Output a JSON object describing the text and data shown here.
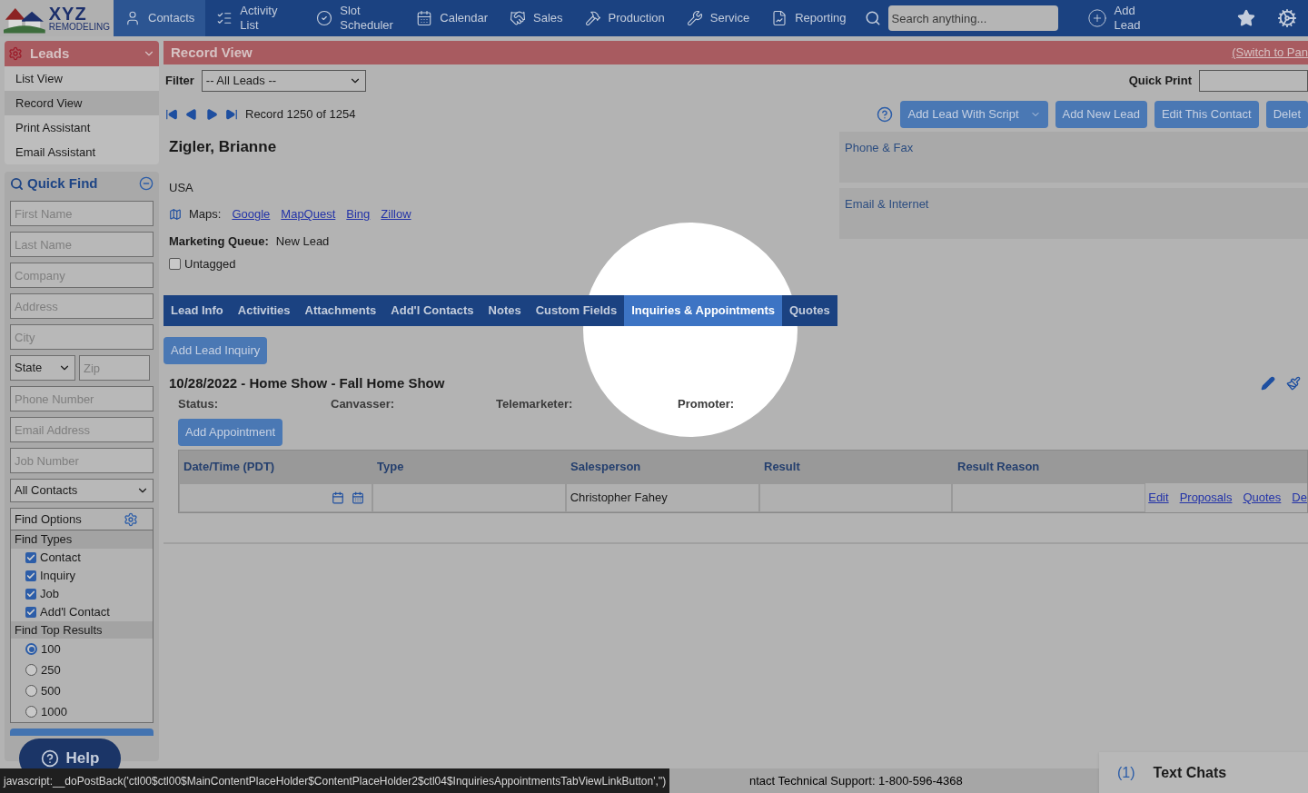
{
  "logo": {
    "title": "XYZ",
    "subtitle": "REMODELING"
  },
  "nav": [
    {
      "label": "Contacts",
      "selected": true
    },
    {
      "label": "Activity List",
      "selected": false
    },
    {
      "label": "Slot Scheduler",
      "selected": false
    },
    {
      "label": "Calendar",
      "selected": false
    },
    {
      "label": "Sales",
      "selected": false
    },
    {
      "label": "Production",
      "selected": false
    },
    {
      "label": "Service",
      "selected": false
    },
    {
      "label": "Reporting",
      "selected": false
    }
  ],
  "search": {
    "placeholder": "Search anything..."
  },
  "add_lead": "Add Lead",
  "sidebar": {
    "title": "Leads",
    "items": [
      {
        "label": "List View",
        "selected": false
      },
      {
        "label": "Record View",
        "selected": true
      },
      {
        "label": "Print Assistant",
        "selected": false
      },
      {
        "label": "Email Assistant",
        "selected": false
      }
    ],
    "quick_find": {
      "title": "Quick Find",
      "fields": [
        {
          "placeholder": "First Name"
        },
        {
          "placeholder": "Last Name"
        },
        {
          "placeholder": "Company"
        },
        {
          "placeholder": "Address"
        },
        {
          "placeholder": "City"
        }
      ],
      "state": "State",
      "zip": {
        "placeholder": "Zip"
      },
      "fields2": [
        {
          "placeholder": "Phone Number"
        },
        {
          "placeholder": "Email Address"
        },
        {
          "placeholder": "Job Number"
        }
      ],
      "scope": "All Contacts",
      "options_title": "Find Options",
      "types_title": "Find Types",
      "types": [
        {
          "label": "Contact",
          "checked": true
        },
        {
          "label": "Inquiry",
          "checked": true
        },
        {
          "label": "Job",
          "checked": true
        },
        {
          "label": "Add'l Contact",
          "checked": true
        }
      ],
      "top_title": "Find Top Results",
      "top": [
        {
          "label": "100",
          "selected": true
        },
        {
          "label": "250",
          "selected": false
        },
        {
          "label": "500",
          "selected": false
        },
        {
          "label": "1000",
          "selected": false
        }
      ]
    }
  },
  "help": "Help",
  "record": {
    "title": "Record View",
    "switch_link": "(Switch to Pan",
    "filter_label": "Filter",
    "filter_value": "-- All Leads --",
    "quick_print": "Quick Print",
    "counter": "Record 1250 of 1254",
    "buttons": [
      {
        "label": "Add Lead With Script",
        "dropdown": true
      },
      {
        "label": "Add New Lead",
        "dropdown": false
      },
      {
        "label": "Edit This Contact",
        "dropdown": false
      },
      {
        "label": "Delet",
        "dropdown": false
      }
    ],
    "name": "Zigler, Brianne",
    "country": "USA",
    "maps_label": "Maps:",
    "maps": [
      "Google",
      "MapQuest",
      "Bing",
      "Zillow"
    ],
    "queue_label": "Marketing Queue:",
    "queue": "New Lead",
    "untagged": {
      "label": "Untagged",
      "checked": false
    },
    "side_sections": [
      "Phone & Fax",
      "Email & Internet"
    ]
  },
  "tabs": [
    {
      "label": "Lead Info",
      "selected": false
    },
    {
      "label": "Activities",
      "selected": false
    },
    {
      "label": "Attachments",
      "selected": false
    },
    {
      "label": "Add'l Contacts",
      "selected": false
    },
    {
      "label": "Notes",
      "selected": false
    },
    {
      "label": "Custom Fields",
      "selected": false
    },
    {
      "label": "Inquiries & Appointments",
      "selected": true
    },
    {
      "label": "Quotes",
      "selected": false
    }
  ],
  "inquiry": {
    "add_button": "Add Lead Inquiry",
    "heading": "10/28/2022 - Home Show - Fall Home Show",
    "fields": [
      "Status:",
      "Canvasser:",
      "Telemarketer:",
      "Promoter:"
    ],
    "add_appointment": "Add Appointment",
    "columns": [
      "Date/Time (PDT)",
      "Type",
      "Salesperson",
      "Result",
      "Result Reason"
    ],
    "rows": [
      {
        "type": "",
        "salesperson": "Christopher Fahey",
        "result": "",
        "reason": "",
        "links": [
          "Edit",
          "Proposals",
          "Quotes",
          "De"
        ]
      }
    ]
  },
  "status_url": "javascript:__doPostBack('ctl00$ctl00$MainContentPlaceHolder$ContentPlaceHolder2$ctl04$InquiriesAppointmentsTabViewLinkButton','')",
  "support": "ntact Technical Support: 1-800-596-4368",
  "chats": {
    "count": "(1)",
    "label": "Text Chats"
  }
}
